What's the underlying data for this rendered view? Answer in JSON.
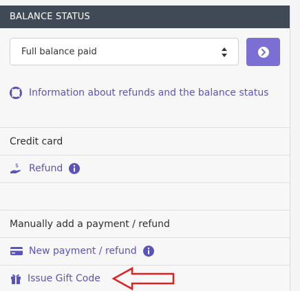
{
  "header": {
    "title": "BALANCE STATUS"
  },
  "balance_select": {
    "value": "Full balance paid"
  },
  "info_link": {
    "label": "Information about refunds and the balance status"
  },
  "credit_card": {
    "label": "Credit card",
    "refund_label": "Refund"
  },
  "manual": {
    "label": "Manually add a payment / refund",
    "new_payment_label": "New payment / refund",
    "gift_code_label": "Issue Gift Code"
  },
  "colors": {
    "header_bg": "#3f4a56",
    "accent": "#7b6fd4",
    "link": "#5a54b8",
    "annotation": "#e02020"
  }
}
